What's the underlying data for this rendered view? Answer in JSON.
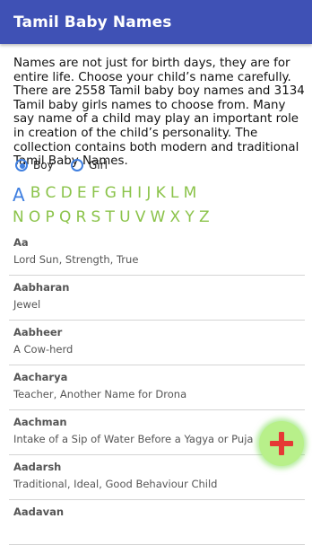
{
  "app": {
    "title": "Tamil Baby Names"
  },
  "intro": "Names are not just for birth days, they are for entire life. Choose your child’s name carefully. There are 2558 Tamil baby boy names and 3134 Tamil baby girls names to choose from. Many say name of a child may play an important role in creation of the child’s personality. The collection contains both modern and traditional Tamil Baby Names.",
  "gender": {
    "options": [
      "Boy",
      "Girl"
    ],
    "selected": "Boy"
  },
  "alphabet": {
    "row1": [
      "A",
      "B",
      "C",
      "D",
      "E",
      "F",
      "G",
      "H",
      "I",
      "J",
      "K",
      "L",
      "M"
    ],
    "row2": [
      "N",
      "O",
      "P",
      "Q",
      "R",
      "S",
      "T",
      "U",
      "V",
      "W",
      "X",
      "Y",
      "Z"
    ],
    "selected": "A"
  },
  "names": [
    {
      "name": "Aa",
      "meaning": "Lord Sun, Strength, True"
    },
    {
      "name": "Aabharan",
      "meaning": "Jewel"
    },
    {
      "name": "Aabheer",
      "meaning": "A Cow-herd"
    },
    {
      "name": "Aacharya",
      "meaning": "Teacher, Another Name for Drona"
    },
    {
      "name": "Aachman",
      "meaning": "Intake of a Sip of Water Before a Yagya or Puja"
    },
    {
      "name": "Aadarsh",
      "meaning": "Traditional, Ideal, Good Behaviour Child"
    },
    {
      "name": "Aadavan",
      "meaning": ""
    }
  ],
  "fab": {
    "icon": "plus-icon",
    "color": "#e53935"
  },
  "colors": {
    "appbar": "#3f51b5",
    "accent": "#3f7fe0",
    "letters": "#8bc34a"
  }
}
